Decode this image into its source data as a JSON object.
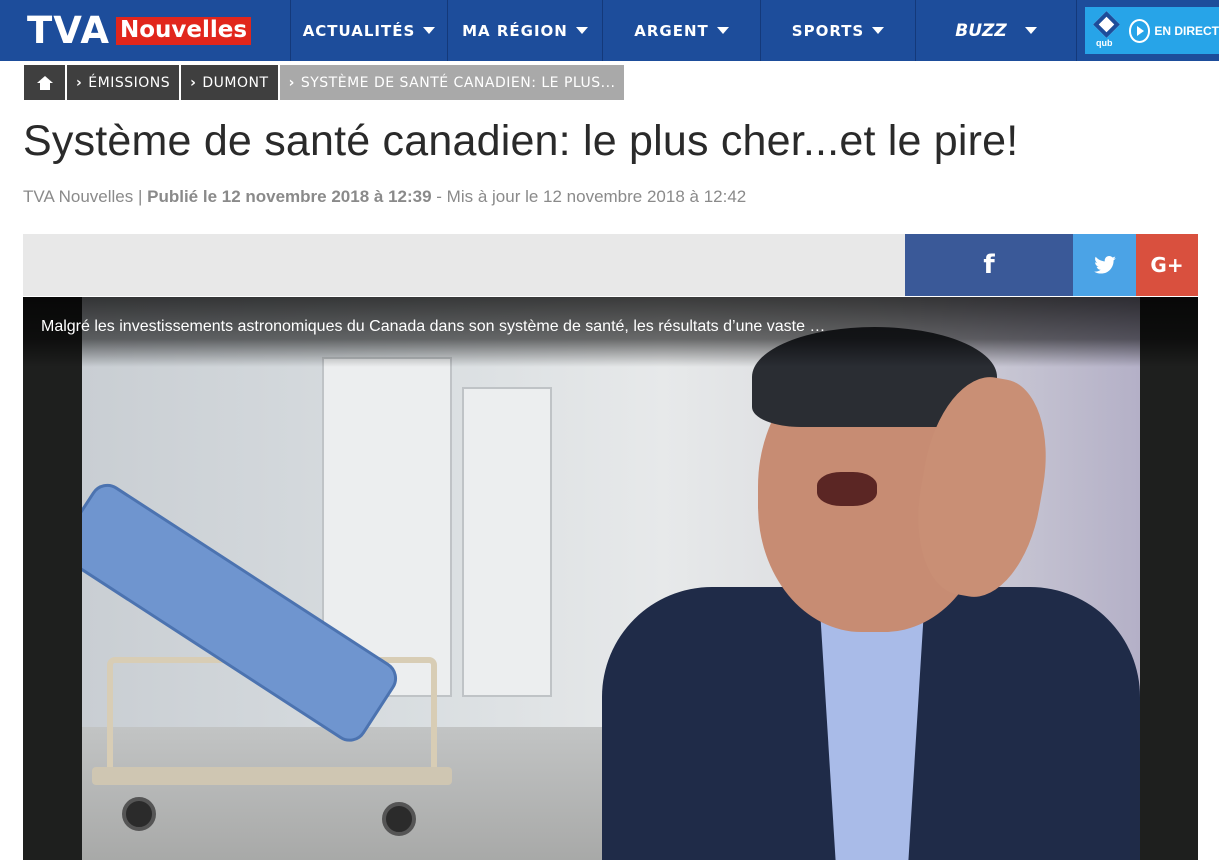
{
  "header": {
    "logo_tva": "TVA",
    "logo_nouvelles": "Nouvelles",
    "nav": [
      {
        "label": "ACTUALITÉS"
      },
      {
        "label": "MA RÉGION"
      },
      {
        "label": "ARGENT"
      },
      {
        "label": "SPORTS"
      },
      {
        "label": "BUZZ"
      }
    ],
    "live": {
      "brand": "qub",
      "label": "EN DIRECT"
    }
  },
  "breadcrumb": {
    "items": [
      {
        "label": "ÉMISSIONS"
      },
      {
        "label": "DUMONT"
      },
      {
        "label": "SYSTÈME DE SANTÉ CANADIEN: LE PLUS..."
      }
    ]
  },
  "article": {
    "title": "Système de santé canadien: le plus cher...et le pire!",
    "byline": {
      "source": "TVA Nouvelles |",
      "published": "Publié le 12 novembre 2018 à 12:39",
      "updated": "- Mis à jour le 12 novembre 2018 à 12:42"
    }
  },
  "share": {
    "facebook": "f",
    "googleplus": "G+"
  },
  "video": {
    "caption": "Malgré les investissements astronomiques du Canada dans son système de santé, les résultats d’une vaste …"
  },
  "colors": {
    "nav_bg": "#1d4d9b",
    "brand_red": "#e1261c",
    "live_blue": "#27a4e8",
    "facebook": "#3a5998",
    "twitter": "#4ba3e6",
    "googleplus": "#d9503e"
  }
}
